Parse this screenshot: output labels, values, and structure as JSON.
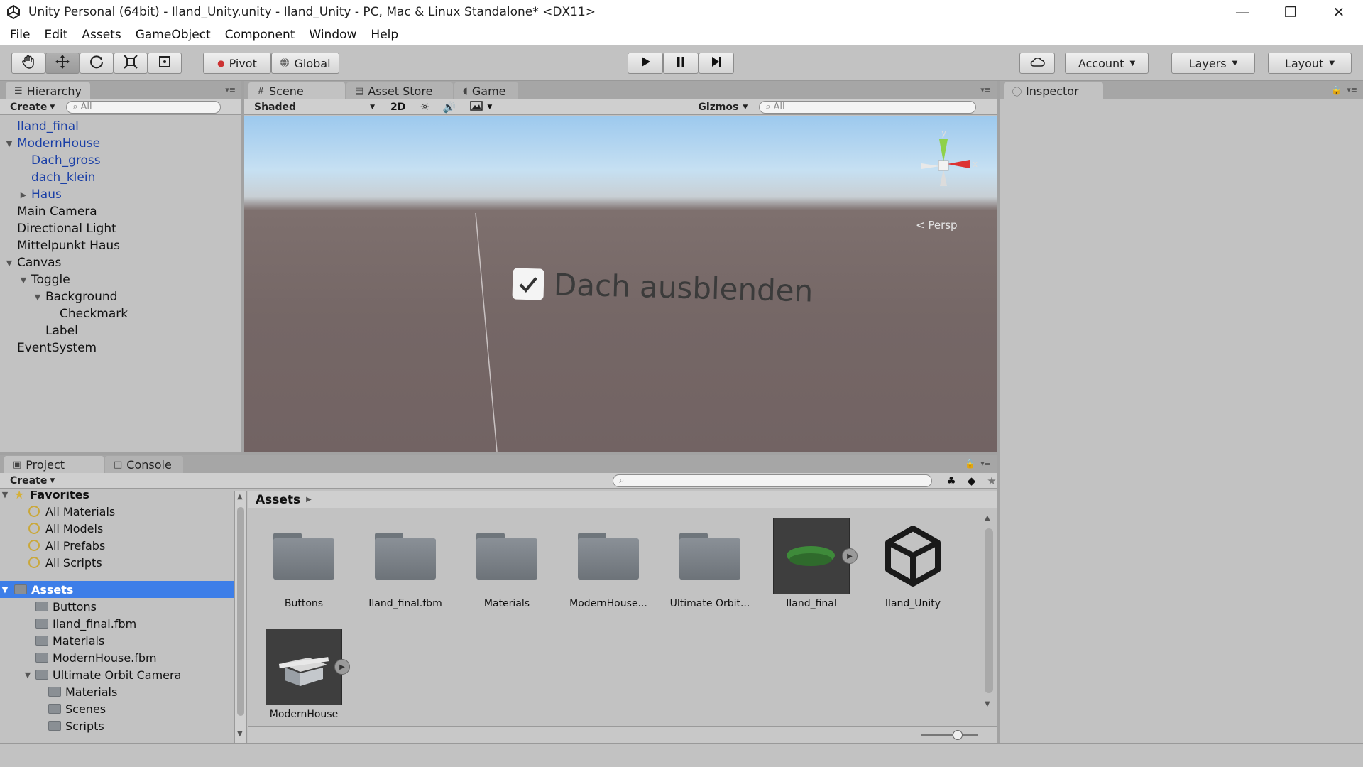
{
  "window": {
    "title": "Unity Personal (64bit) - Iland_Unity.unity - Iland_Unity - PC, Mac & Linux Standalone* <DX11>"
  },
  "menu": [
    "File",
    "Edit",
    "Assets",
    "GameObject",
    "Component",
    "Window",
    "Help"
  ],
  "toolbar": {
    "pivot_label": "Pivot",
    "global_label": "Global",
    "account_label": "Account",
    "layers_label": "Layers",
    "layout_label": "Layout"
  },
  "hierarchy": {
    "tab_label": "Hierarchy",
    "create_label": "Create",
    "search_placeholder": "All",
    "items": [
      {
        "label": "Iland_final",
        "depth": 0,
        "arrow": "",
        "prefab": true
      },
      {
        "label": "ModernHouse",
        "depth": 0,
        "arrow": "▼",
        "prefab": true
      },
      {
        "label": "Dach_gross",
        "depth": 1,
        "arrow": "",
        "prefab": true
      },
      {
        "label": "dach_klein",
        "depth": 1,
        "arrow": "",
        "prefab": true
      },
      {
        "label": "Haus",
        "depth": 1,
        "arrow": "▶",
        "prefab": true
      },
      {
        "label": "Main Camera",
        "depth": 0,
        "arrow": "",
        "prefab": false
      },
      {
        "label": "Directional Light",
        "depth": 0,
        "arrow": "",
        "prefab": false
      },
      {
        "label": "Mittelpunkt Haus",
        "depth": 0,
        "arrow": "",
        "prefab": false
      },
      {
        "label": "Canvas",
        "depth": 0,
        "arrow": "▼",
        "prefab": false
      },
      {
        "label": "Toggle",
        "depth": 1,
        "arrow": "▼",
        "prefab": false
      },
      {
        "label": "Background",
        "depth": 2,
        "arrow": "▼",
        "prefab": false
      },
      {
        "label": "Checkmark",
        "depth": 3,
        "arrow": "",
        "prefab": false
      },
      {
        "label": "Label",
        "depth": 2,
        "arrow": "",
        "prefab": false
      },
      {
        "label": "EventSystem",
        "depth": 0,
        "arrow": "",
        "prefab": false
      }
    ]
  },
  "scene": {
    "tabs": [
      "Scene",
      "Asset Store",
      "Game"
    ],
    "shading_mode": "Shaded",
    "mode_2d": "2D",
    "gizmos_label": "Gizmos",
    "search_placeholder": "All",
    "axis_y": "y",
    "axis_x": "x",
    "persp_label": "< Persp",
    "toggle_label": "Dach ausblenden"
  },
  "inspector": {
    "tab_label": "Inspector"
  },
  "project": {
    "tabs": [
      "Project",
      "Console"
    ],
    "create_label": "Create",
    "favorites_label": "Favorites",
    "favorites": [
      "All Materials",
      "All Models",
      "All Prefabs",
      "All Scripts"
    ],
    "assets_root": "Assets",
    "tree": [
      {
        "label": "Buttons",
        "depth": 1,
        "arrow": ""
      },
      {
        "label": "Iland_final.fbm",
        "depth": 1,
        "arrow": ""
      },
      {
        "label": "Materials",
        "depth": 1,
        "arrow": ""
      },
      {
        "label": "ModernHouse.fbm",
        "depth": 1,
        "arrow": ""
      },
      {
        "label": "Ultimate Orbit Camera",
        "depth": 1,
        "arrow": "▼"
      },
      {
        "label": "Materials",
        "depth": 2,
        "arrow": ""
      },
      {
        "label": "Scenes",
        "depth": 2,
        "arrow": ""
      },
      {
        "label": "Scripts",
        "depth": 2,
        "arrow": ""
      }
    ],
    "breadcrumb": "Assets",
    "assets": [
      {
        "label": "Buttons",
        "kind": "folder"
      },
      {
        "label": "Iland_final.fbm",
        "kind": "folder"
      },
      {
        "label": "Materials",
        "kind": "folder"
      },
      {
        "label": "ModernHouse...",
        "kind": "folder"
      },
      {
        "label": "Ultimate Orbit...",
        "kind": "folder"
      },
      {
        "label": "Iland_final",
        "kind": "model-island"
      },
      {
        "label": "Iland_Unity",
        "kind": "unity-scene"
      },
      {
        "label": "ModernHouse",
        "kind": "model-house"
      }
    ]
  }
}
